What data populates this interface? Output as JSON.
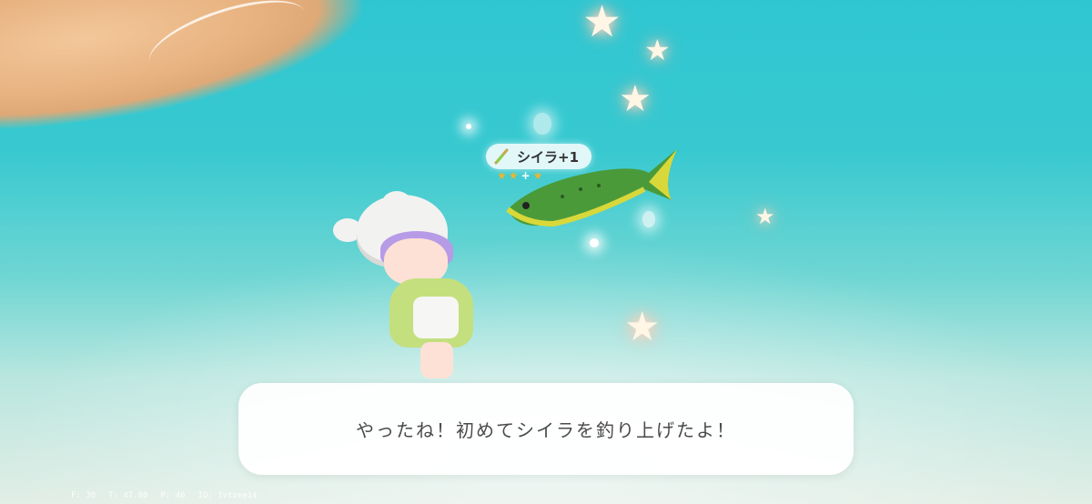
{
  "item_notification": {
    "label": "シイラ+1",
    "icon": "fish-rod-icon",
    "stars": [
      "★",
      "★"
    ],
    "stars_plus": "+",
    "star_extra": "★",
    "star_color": "#e9b630"
  },
  "dialog": {
    "text": "やったね！初めてシイラを釣り上げたよ！"
  },
  "debug": {
    "f": "F: 30",
    "t": "T: 47.80",
    "p": "P: 46",
    "id": "ID: 1vtzee14"
  },
  "colors": {
    "water": "#38c9d0",
    "sand": "#e7b27f",
    "fish_body": "#4a9a3a",
    "fish_fin": "#d8d83a"
  }
}
